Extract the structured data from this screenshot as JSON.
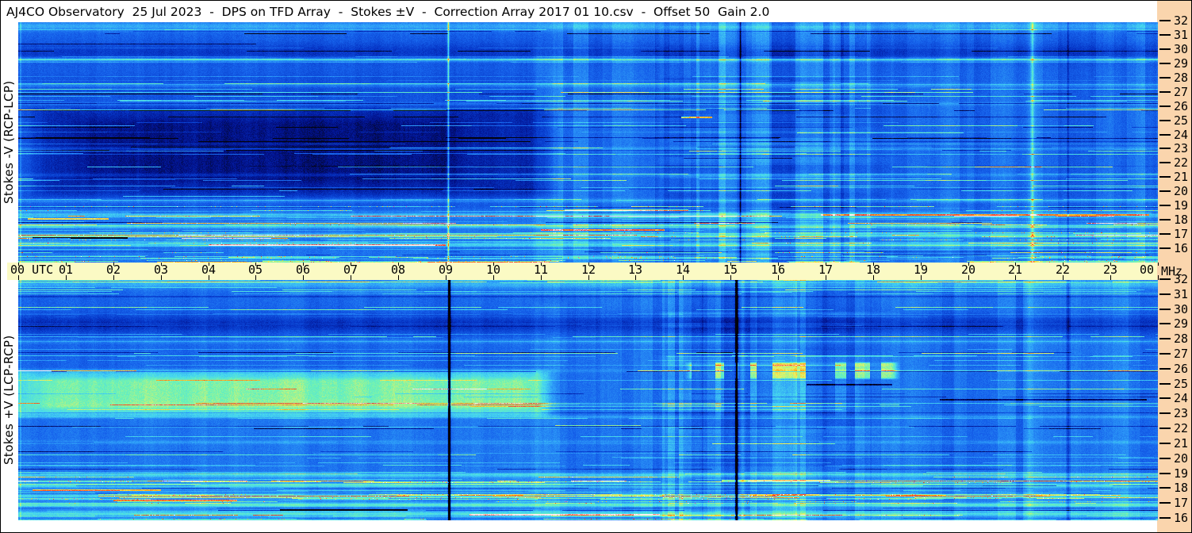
{
  "title_bar": {
    "text": "AJ4CO Observatory  25 Jul 2023  -  DPS on TFD Array  -  Stokes ±V  -  Correction Array 2017 01 10.csv  -  Offset 50  Gain 2.0"
  },
  "time_axis": {
    "unit": "UTC",
    "hours": [
      "00",
      "01",
      "02",
      "03",
      "04",
      "05",
      "06",
      "07",
      "08",
      "09",
      "10",
      "11",
      "12",
      "13",
      "14",
      "15",
      "16",
      "17",
      "18",
      "19",
      "20",
      "21",
      "22",
      "23",
      "00"
    ],
    "strip_color": "#FBFAC4"
  },
  "freq_axis": {
    "unit": "MHz",
    "ticks": [
      32,
      31,
      30,
      29,
      28,
      27,
      26,
      25,
      24,
      23,
      22,
      21,
      20,
      19,
      18,
      17,
      16
    ],
    "strip_color": "#FAD5AD"
  },
  "colormap": [
    [
      0.0,
      [
        3,
        3,
        12
      ]
    ],
    [
      0.1,
      [
        2,
        18,
        140
      ]
    ],
    [
      0.2,
      [
        6,
        55,
        200
      ]
    ],
    [
      0.32,
      [
        22,
        98,
        235
      ]
    ],
    [
      0.45,
      [
        45,
        155,
        248
      ]
    ],
    [
      0.57,
      [
        70,
        215,
        238
      ]
    ],
    [
      0.67,
      [
        110,
        242,
        180
      ]
    ],
    [
      0.77,
      [
        235,
        242,
        95
      ]
    ],
    [
      0.85,
      [
        252,
        170,
        30
      ]
    ],
    [
      0.92,
      [
        240,
        60,
        40
      ]
    ],
    [
      1.0,
      [
        255,
        240,
        240
      ]
    ]
  ],
  "speckle_colors": [
    "#ffffff",
    "#e83cc8",
    "#ff4422",
    "#ffd718"
  ],
  "chart_data": [
    {
      "type": "heatmap",
      "id": "stokes_neg_v",
      "label": "Stokes -V (RCP-LCP)",
      "x": {
        "label": "UTC",
        "min": 0,
        "max": 24,
        "tick_step": 1
      },
      "y": {
        "label": "MHz",
        "min": 16,
        "max": 32,
        "tick_step": 1
      },
      "seed": 11,
      "base": 0.32,
      "bands": [
        {
          "f": 31.85,
          "h": 0.22,
          "dv": 0.16
        },
        {
          "f": 30.0,
          "h": 0.45,
          "dv": -0.11
        },
        {
          "f": 29.5,
          "h": 0.12,
          "dv": 0.2
        },
        {
          "f": 27.7,
          "h": 0.1,
          "dv": 0.1
        },
        {
          "f": 26.4,
          "h": 0.09,
          "dv": 0.08
        },
        {
          "f": 23.25,
          "h": 0.08,
          "dv": 0.1
        },
        {
          "f": 21.4,
          "h": 0.08,
          "dv": 0.08
        },
        {
          "f": 19.6,
          "h": 0.1,
          "dv": 0.12
        },
        {
          "f": 18.6,
          "h": 0.12,
          "dv": 0.16
        },
        {
          "f": 17.8,
          "h": 0.1,
          "dv": 0.2
        },
        {
          "f": 17.15,
          "h": 0.1,
          "dv": 0.24
        },
        {
          "f": 16.5,
          "h": 0.12,
          "dv": 0.2
        }
      ],
      "rects": [
        {
          "t": [
            0.7,
            10.92
          ],
          "f": [
            20.4,
            25.6
          ],
          "dv": -0.125,
          "ft": 0.7,
          "ff": 0.9
        },
        {
          "t": [
            1.8,
            8.8
          ],
          "f": [
            21.3,
            24.9
          ],
          "dv": -0.06,
          "ft": 1.0,
          "ff": 0.8
        },
        {
          "t": [
            0,
            10.92
          ],
          "f": [
            20,
            28
          ],
          "dv": -0.035,
          "ft": 0.5,
          "ff": 1.2
        },
        {
          "t": [
            10.92,
            24
          ],
          "f": [
            15,
            32.2
          ],
          "dv": 0.02,
          "ft": 0.05,
          "ff": 0.1
        },
        {
          "t": [
            0,
            24
          ],
          "f": [
            15,
            18.7
          ],
          "dv": 0.05,
          "ft": 0.1,
          "ff": 0.5
        },
        {
          "t": [
            10.92,
            11.45
          ],
          "f": [
            15,
            30
          ],
          "dv": 0.045,
          "ft": 0.15,
          "ff": 1
        },
        {
          "t": [
            14.55,
            15.1
          ],
          "f": [
            15,
            32.2
          ],
          "dv": 0.04,
          "ft": 0.1,
          "ff": 0.5
        }
      ],
      "vlines": [
        {
          "t": 0.04,
          "w": 2,
          "dv": 0.13
        },
        {
          "t": 9.05,
          "w": 2.4,
          "dv": 0.34
        },
        {
          "t": 15.2,
          "w": 2,
          "dv": -0.28
        },
        {
          "t": 21.35,
          "w": 11,
          "dv": 0.1
        },
        {
          "t": 21.35,
          "w": 3,
          "dv": 0.14
        },
        {
          "t": 22.1,
          "w": 2,
          "dv": -0.12
        }
      ],
      "hlines": [
        {
          "f": 29.55,
          "t": [
            0,
            24
          ],
          "dv": 0.16,
          "w": 2
        },
        {
          "f": 27.75,
          "t": [
            0,
            24
          ],
          "dv": 0.09,
          "w": 1
        },
        {
          "f": 30.6,
          "t": [
            0,
            5.0
          ],
          "dv": -0.2,
          "w": 1
        },
        {
          "f": 25.45,
          "t": [
            13.95,
            14.6
          ],
          "dv": 0.5,
          "w": 2
        },
        {
          "f": 24.35,
          "t": [
            16.4,
            19.9
          ],
          "dv": 0.3,
          "w": 1
        },
        {
          "f": 23.3,
          "t": [
            7.8,
            12.3
          ],
          "dv": 0.28,
          "w": 1
        },
        {
          "f": 22.6,
          "t": [
            14.0,
            16.3
          ],
          "dv": -0.24,
          "w": 1
        },
        {
          "f": 21.05,
          "t": [
            0,
            3.3
          ],
          "dv": 0.12,
          "w": 1
        },
        {
          "f": 19.9,
          "t": [
            2.2,
            5.6
          ],
          "dv": 0.3,
          "w": 1
        },
        {
          "f": 18.95,
          "t": [
            11.5,
            14.1
          ],
          "dv": 0.34,
          "w": 2
        },
        {
          "f": 18.6,
          "t": [
            16.9,
            23.8
          ],
          "dv": 0.35,
          "w": 2
        },
        {
          "f": 18.35,
          "t": [
            0.2,
            1.9
          ],
          "dv": 0.42,
          "w": 2
        },
        {
          "f": 17.55,
          "t": [
            11.0,
            13.6
          ],
          "dv": 0.5,
          "w": 2
        },
        {
          "f": 17.0,
          "t": [
            0.3,
            2.3
          ],
          "dv": -0.45,
          "w": 2
        },
        {
          "f": 16.5,
          "t": [
            4.0,
            9.0
          ],
          "dv": 0.4,
          "w": 2
        }
      ],
      "grid": {
        "t": [
          13.75,
          17.4
        ],
        "vamp": 0.07,
        "hamp": 0.05
      },
      "block_noise": {
        "t_start": 10.92,
        "amp": 0.05
      },
      "streaks": {
        "dense_below_mhz": 19.0,
        "p_dense": 0.5,
        "p_mid": 0.14,
        "amp": [
          0.06,
          0.32
        ],
        "neg_p": 0.07
      }
    },
    {
      "type": "heatmap",
      "id": "stokes_pos_v",
      "label": "Stokes +V (LCP-RCP)",
      "x": {
        "label": "UTC",
        "min": 0,
        "max": 24,
        "tick_step": 1
      },
      "y": {
        "label": "MHz",
        "min": 16,
        "max": 32,
        "tick_step": 1
      },
      "seed": 77,
      "base": 0.33,
      "bands": [
        {
          "f": 31.8,
          "h": 0.22,
          "dv": 0.16
        },
        {
          "f": 29.1,
          "h": 0.45,
          "dv": -0.15
        },
        {
          "f": 27.95,
          "h": 0.1,
          "dv": 0.08
        },
        {
          "f": 26.0,
          "h": 0.08,
          "dv": 0.06
        },
        {
          "f": 22.9,
          "h": 0.07,
          "dv": 0.1
        },
        {
          "f": 21.2,
          "h": 0.08,
          "dv": 0.09
        },
        {
          "f": 19.0,
          "h": 0.1,
          "dv": 0.16
        },
        {
          "f": 18.3,
          "h": 0.1,
          "dv": 0.2
        },
        {
          "f": 17.6,
          "h": 0.09,
          "dv": 0.18
        },
        {
          "f": 17.0,
          "h": 0.1,
          "dv": 0.24
        },
        {
          "f": 16.4,
          "h": 0.12,
          "dv": 0.2
        }
      ],
      "rects": [
        {
          "t": [
            0,
            10.9
          ],
          "f": [
            23.25,
            25.7
          ],
          "dv": 0.24,
          "ft": 0.5,
          "ff": 0.55
        },
        {
          "t": [
            0.7,
            10.5
          ],
          "f": [
            23.7,
            25.25
          ],
          "dv": 0.11,
          "ft": 0.8,
          "ff": 0.45
        },
        {
          "t": [
            0,
            11.0
          ],
          "f": [
            15.8,
            23.3
          ],
          "dv": 0.035,
          "ft": 0.3,
          "ff": 1.0
        },
        {
          "t": [
            10.9,
            24
          ],
          "f": [
            15.8,
            32.1
          ],
          "dv": 0.02,
          "ft": 0.05,
          "ff": 0.1
        },
        {
          "t": [
            0,
            24
          ],
          "f": [
            15.8,
            18.8
          ],
          "dv": 0.04,
          "ft": 0.1,
          "ff": 0.5
        },
        {
          "t": [
            14.25,
            18.35
          ],
          "f": [
            25.55,
            26.45
          ],
          "dv": 0.33,
          "ft": 0.25,
          "ff": 0.18,
          "dash": true
        },
        {
          "t": [
            14.3,
            17.5
          ],
          "f": [
            23.2,
            25.2
          ],
          "dv": 0.08,
          "ft": 0.3,
          "ff": 0.4,
          "dash": true
        },
        {
          "t": [
            10.9,
            11.45
          ],
          "f": [
            15.8,
            30
          ],
          "dv": 0.04,
          "ft": 0.15,
          "ff": 1
        }
      ],
      "vlines": [
        {
          "t": 0.04,
          "w": 2,
          "dv": 0.12
        },
        {
          "t": 9.07,
          "w": 2.6,
          "dv": -1.2
        },
        {
          "t": 15.12,
          "w": 2.6,
          "dv": -1.2
        },
        {
          "t": 15.25,
          "w": 6,
          "dv": 0.12
        },
        {
          "t": 21.3,
          "w": 9,
          "dv": 0.08
        },
        {
          "t": 22.1,
          "w": 2,
          "dv": -0.1
        }
      ],
      "hlines": [
        {
          "f": 31.0,
          "t": [
            0,
            24
          ],
          "dv": -0.1,
          "w": 2
        },
        {
          "f": 27.95,
          "t": [
            0,
            24
          ],
          "dv": 0.08,
          "w": 1
        },
        {
          "f": 26.0,
          "t": [
            0,
            0.7
          ],
          "dv": 0.3,
          "w": 2
        },
        {
          "f": 25.1,
          "t": [
            16.6,
            18.4
          ],
          "dv": -0.3,
          "w": 2
        },
        {
          "f": 24.05,
          "t": [
            19.4,
            23.75
          ],
          "dv": -0.28,
          "w": 2
        },
        {
          "f": 23.15,
          "t": [
            0,
            24
          ],
          "dv": -0.14,
          "w": 1
        },
        {
          "f": 22.3,
          "t": [
            11.3,
            13.1
          ],
          "dv": 0.34,
          "w": 1
        },
        {
          "f": 21.1,
          "t": [
            14.6,
            17.2
          ],
          "dv": 0.3,
          "w": 1
        },
        {
          "f": 20.2,
          "t": [
            12.5,
            23.9
          ],
          "dv": 0.1,
          "w": 1
        },
        {
          "f": 18.65,
          "t": [
            14.8,
            17.1
          ],
          "dv": 0.38,
          "w": 2
        },
        {
          "f": 18.0,
          "t": [
            0.3,
            3.0
          ],
          "dv": 0.42,
          "w": 2
        },
        {
          "f": 17.35,
          "t": [
            2.0,
            4.6
          ],
          "dv": 0.45,
          "w": 2
        },
        {
          "f": 16.7,
          "t": [
            5.5,
            8.2
          ],
          "dv": -0.45,
          "w": 2
        },
        {
          "f": 16.35,
          "t": [
            9.5,
            13.5
          ],
          "dv": 0.4,
          "w": 2
        }
      ],
      "grid": {
        "t": [
          13.75,
          17.4
        ],
        "vamp": 0.08,
        "hamp": 0.05
      },
      "block_noise": {
        "t_start": 10.92,
        "amp": 0.05
      },
      "streaks": {
        "dense_below_mhz": 19.0,
        "p_dense": 0.5,
        "p_mid": 0.12,
        "amp": [
          0.06,
          0.3
        ],
        "neg_p": 0.07
      }
    }
  ]
}
